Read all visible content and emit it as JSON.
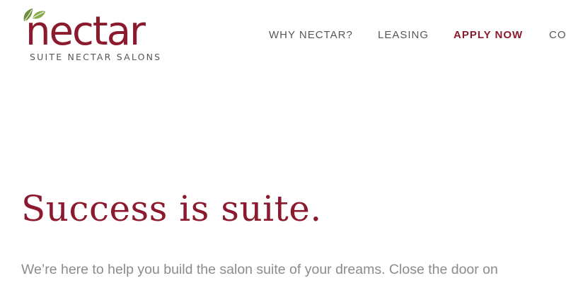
{
  "logo": {
    "wordmark": "nectar",
    "tagline": "SUITE NECTAR SALONS",
    "leaf_icon": "leaf-icon",
    "leaf_color": "#6d8f3c"
  },
  "nav": {
    "items": [
      {
        "label": "WHY NECTAR?",
        "active": false
      },
      {
        "label": "LEASING",
        "active": false
      },
      {
        "label": "APPLY NOW",
        "active": true
      },
      {
        "label": "CO",
        "active": false
      }
    ]
  },
  "hero": {
    "title": "Success is suite.",
    "body": "We’re here to help you build the salon suite of your dreams. Close the door on"
  },
  "colors": {
    "brand": "#8b1a2e",
    "text_gray": "#55565a",
    "body_gray": "#8a8b8e"
  }
}
